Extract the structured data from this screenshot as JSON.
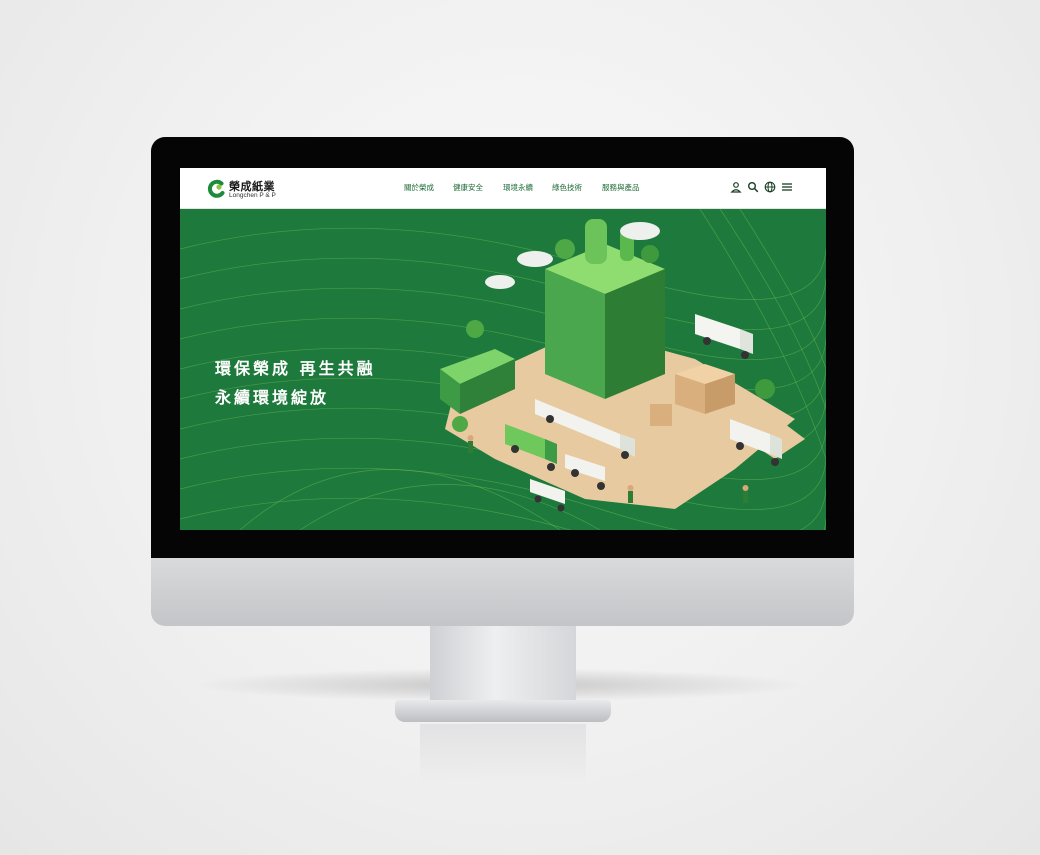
{
  "site": {
    "logo": {
      "name_cn": "榮成紙業",
      "name_en": "Longchen P & P"
    },
    "nav": [
      {
        "label": "關於榮成"
      },
      {
        "label": "健康安全"
      },
      {
        "label": "環境永續"
      },
      {
        "label": "綠色技術"
      },
      {
        "label": "服務與產品"
      }
    ],
    "header_icons": [
      "user-icon",
      "search-icon",
      "globe-icon",
      "menu-icon"
    ],
    "hero": {
      "headline_line1": "環保榮成 再生共融",
      "headline_line2": "永續環境綻放"
    }
  },
  "colors": {
    "brand_green": "#1e7a3c",
    "nav_text": "#1b6a35",
    "hero_line": "#8fcf6a",
    "header_bg": "#ffffff"
  }
}
